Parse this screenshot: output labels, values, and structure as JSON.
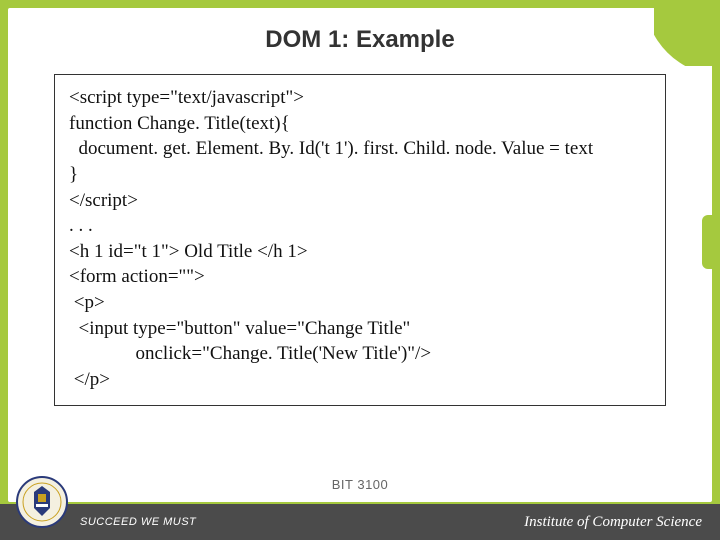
{
  "title": "DOM 1: Example",
  "code": {
    "l1": "<script type=\"text/javascript\">",
    "l2": "function Change. Title(text){",
    "l3": "  document. get. Element. By. Id('t 1'). first. Child. node. Value = text",
    "l4": "}",
    "l5": "</script>",
    "l6": ". . .",
    "l7": "<h 1 id=\"t 1\"> Old Title </h 1>",
    "l8": "<form action=\"\">",
    "l9": " <p>",
    "l10": "  <input type=\"button\" value=\"Change Title\"",
    "l11": "              onclick=\"Change. Title('New Title')\"/>",
    "l12": " </p>"
  },
  "course_code": "BIT 3100",
  "footer": {
    "motto": "SUCCEED WE MUST",
    "institute": "Institute of Computer Science"
  }
}
